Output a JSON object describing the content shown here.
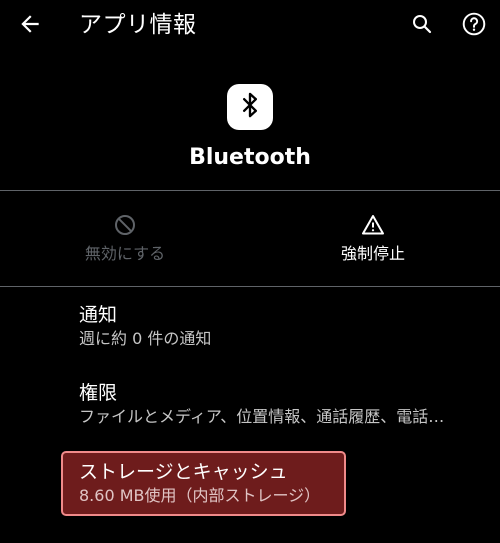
{
  "header": {
    "title": "アプリ情報",
    "back_icon": "arrow-back-icon",
    "search_icon": "search-icon",
    "help_icon": "help-circle-icon"
  },
  "app": {
    "name": "Bluetooth",
    "icon": "bluetooth-icon"
  },
  "actions": {
    "disable": {
      "label": "無効にする",
      "icon": "block-icon",
      "enabled": false
    },
    "force_stop": {
      "label": "強制停止",
      "icon": "warning-icon",
      "enabled": true
    }
  },
  "preferences": {
    "notifications": {
      "title": "通知",
      "summary": "週に約 0 件の通知"
    },
    "permissions": {
      "title": "権限",
      "summary": "ファイルとメディア、位置情報、通話履歴、電話…"
    },
    "storage": {
      "title": "ストレージとキャッシュ",
      "summary": "8.60 MB使用（内部ストレージ）",
      "highlighted": true
    }
  },
  "colors": {
    "background": "#000000",
    "divider": "#5f6368",
    "disabled_text": "#5f6368",
    "summary_text": "#c6c6c6",
    "highlight_border": "#f08a8a",
    "highlight_fill": "#6e1c1c"
  }
}
